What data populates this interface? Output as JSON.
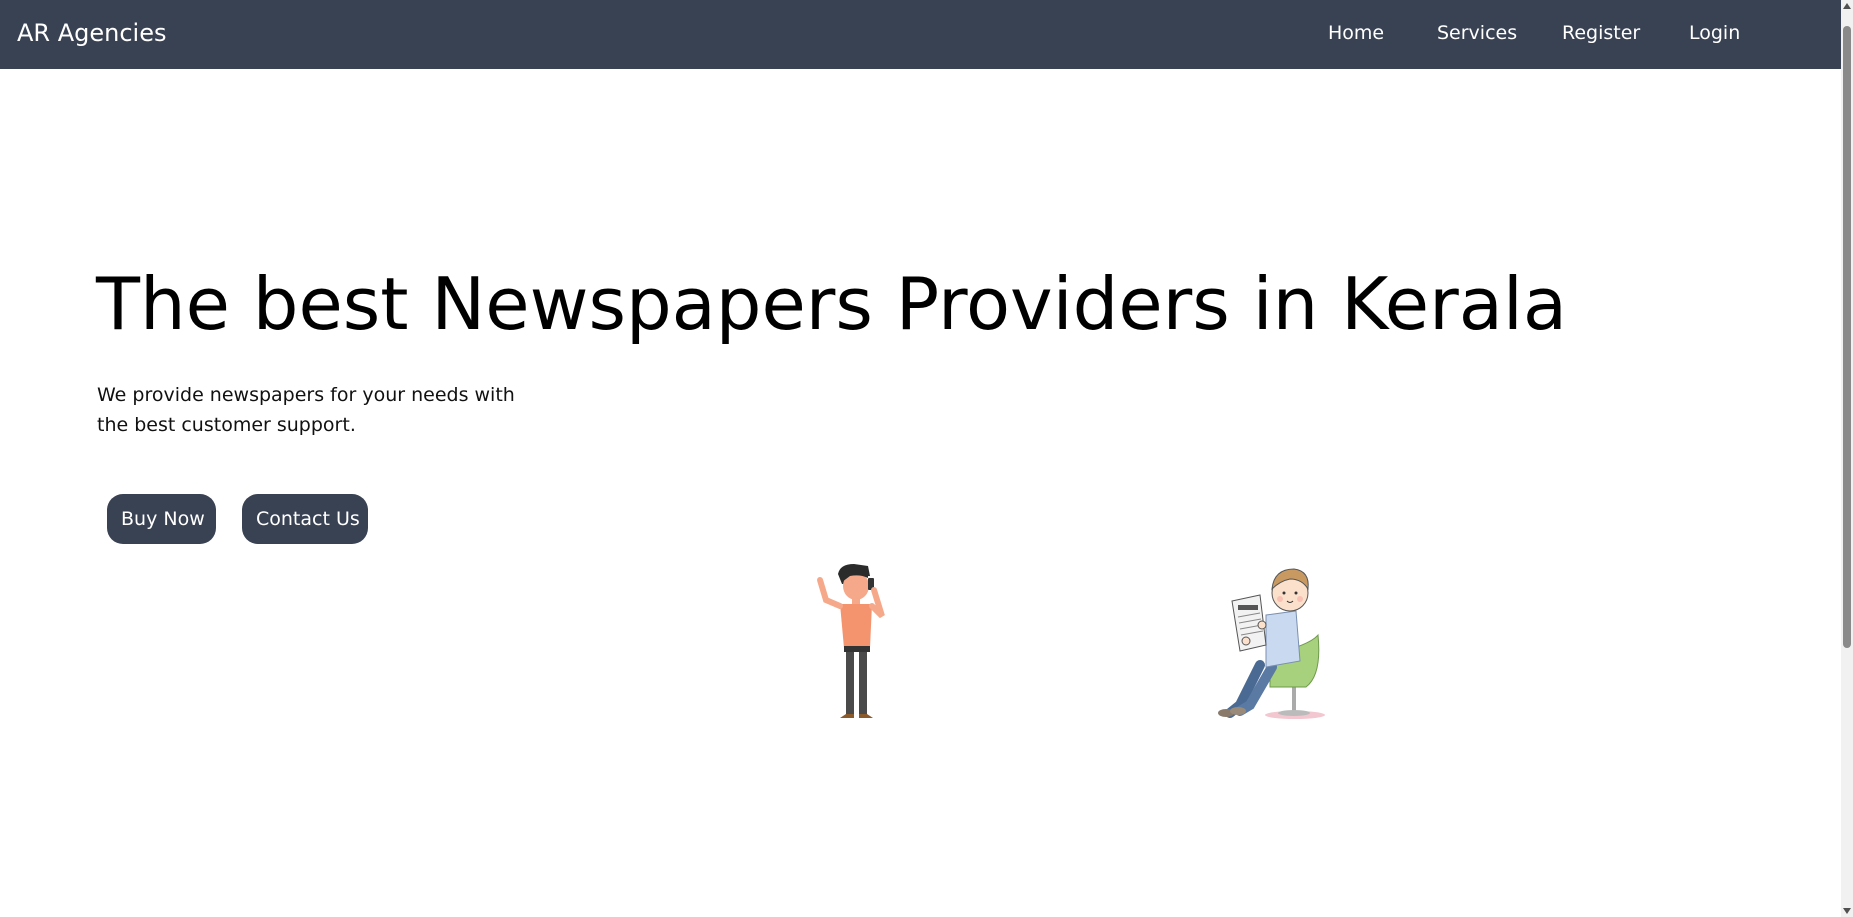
{
  "navbar": {
    "brand": "AR Agencies",
    "links": [
      "Home",
      "Services",
      "Register",
      "Login"
    ]
  },
  "hero": {
    "title": "The best Newspapers Providers in Kerala",
    "subtitle": "We provide newspapers for your needs with the best customer support.",
    "buttons": {
      "buy": "Buy Now",
      "contact": "Contact Us"
    }
  },
  "colors": {
    "navbar_bg": "#394253",
    "button_bg": "#394253",
    "page_bg": "#ffffff"
  },
  "icons": {
    "phone_person": "person-on-phone-illustration",
    "reader_person": "person-reading-newspaper-illustration"
  }
}
